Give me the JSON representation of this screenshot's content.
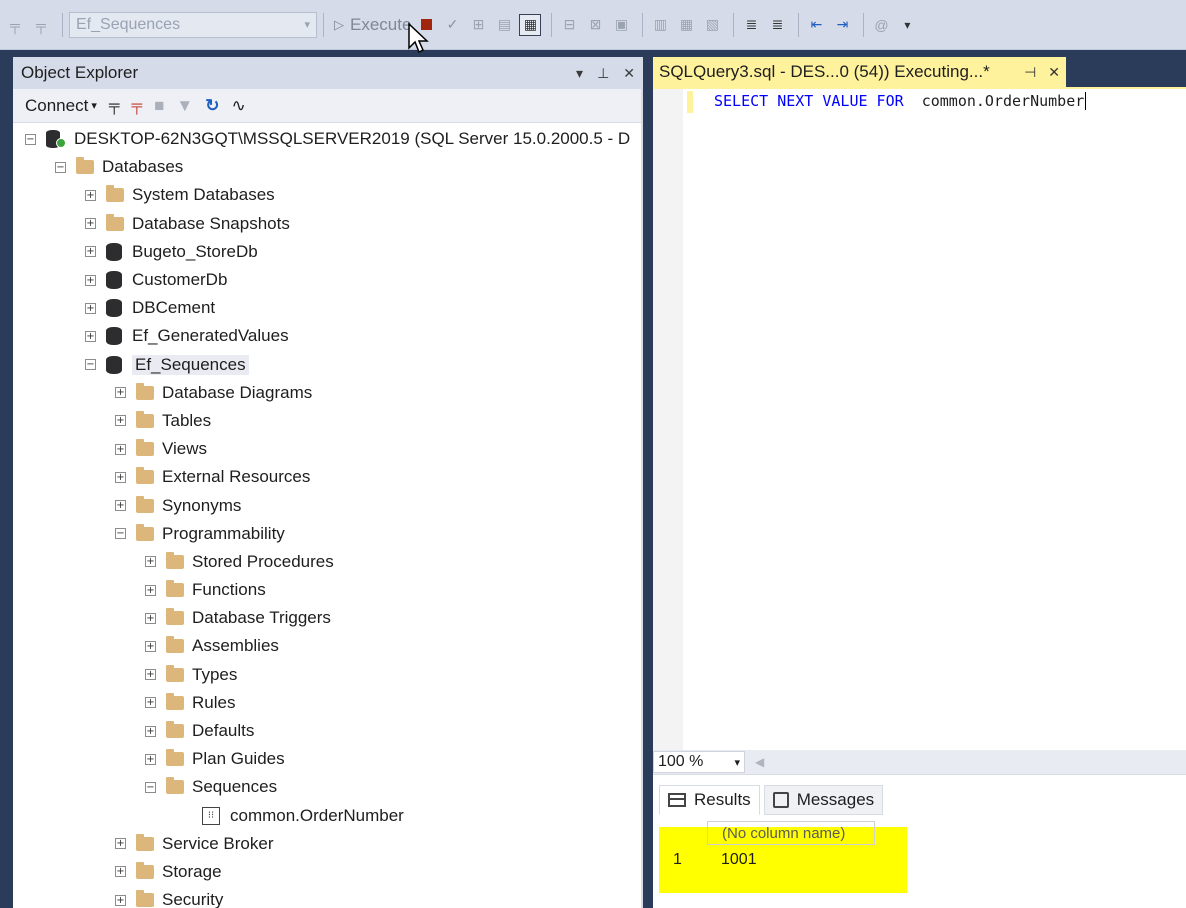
{
  "toolbar": {
    "database": "Ef_Sequences",
    "execute_label": "Execute"
  },
  "object_explorer": {
    "title": "Object Explorer",
    "connect_label": "Connect",
    "server": "DESKTOP-62N3GQT\\MSSQLSERVER2019 (SQL Server 15.0.2000.5 - D",
    "databases_label": "Databases",
    "top_items": [
      "System Databases",
      "Database Snapshots"
    ],
    "databases": [
      "Bugeto_StoreDb",
      "CustomerDb",
      "DBCement",
      "Ef_GeneratedValues",
      "Ef_Sequences"
    ],
    "ef_sequences_children": [
      "Database Diagrams",
      "Tables",
      "Views",
      "External Resources",
      "Synonyms"
    ],
    "programmability": "Programmability",
    "programmability_children": [
      "Stored Procedures",
      "Functions",
      "Database Triggers",
      "Assemblies",
      "Types",
      "Rules",
      "Defaults",
      "Plan Guides"
    ],
    "sequences": "Sequences",
    "sequence_item": "common.OrderNumber",
    "after_items": [
      "Service Broker",
      "Storage",
      "Security"
    ]
  },
  "document": {
    "tab_title": "SQLQuery3.sql - DES...0 (54)) Executing...*",
    "code_keywords": "SELECT NEXT VALUE FOR",
    "code_object": "common.OrderNumber"
  },
  "zoom": {
    "value": "100 %"
  },
  "results": {
    "tabs": [
      "Results",
      "Messages"
    ],
    "column_header": "(No column name)",
    "row_number": "1",
    "cell_value": "1001"
  },
  "colors": {
    "tab_highlight": "#fff29d",
    "result_highlight": "#ffff00",
    "keyword": "#0000ff",
    "folder": "#dcb67a"
  }
}
